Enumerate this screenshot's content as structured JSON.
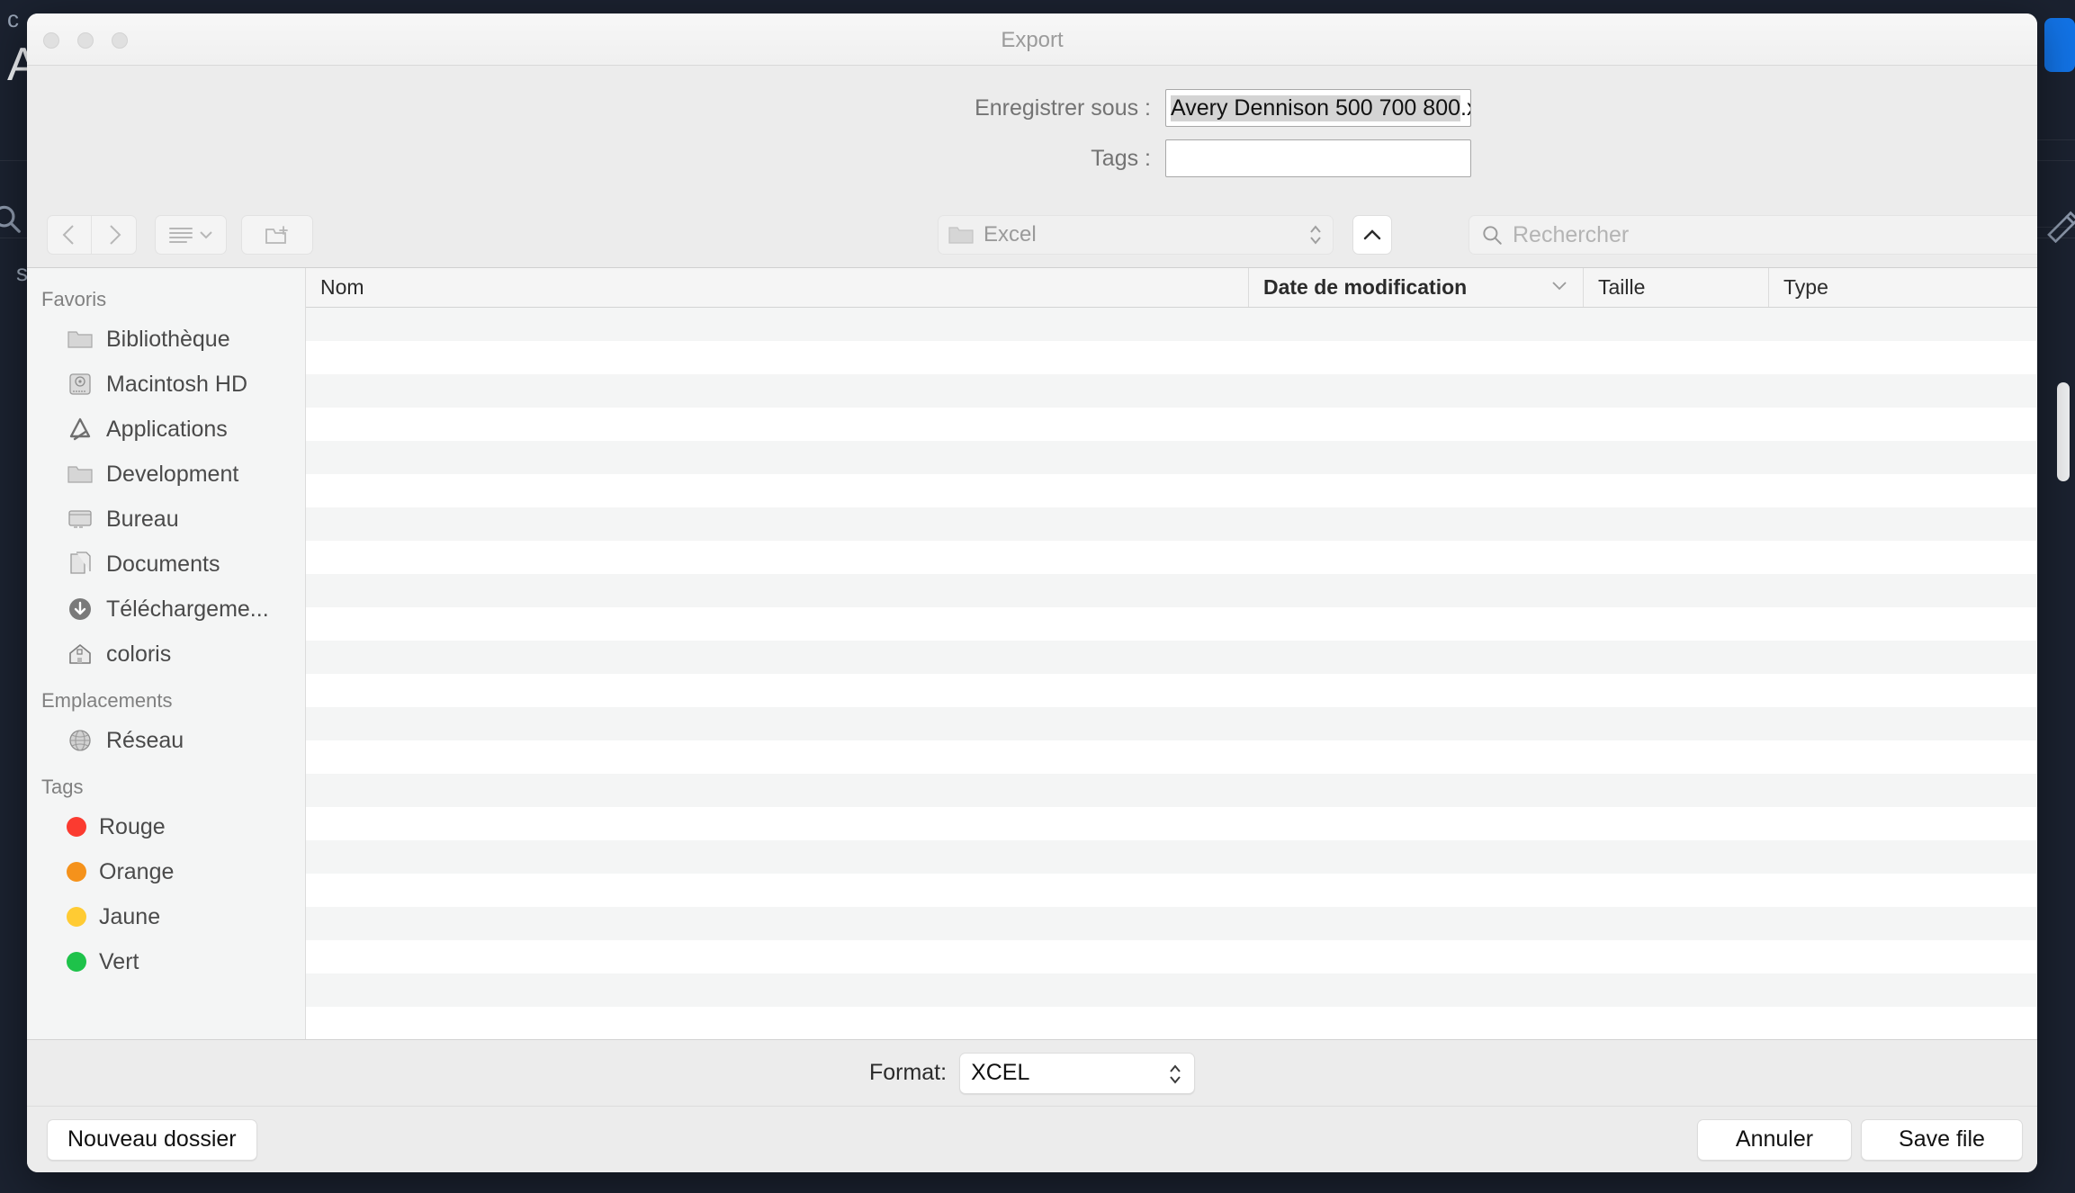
{
  "backdrop": {
    "fragment_top_left": "c",
    "fragment_letter": "A",
    "fragment_side": "s",
    "search_icon": "search-icon",
    "pencil_icon": "pencil-icon",
    "accent_color": "#1273e6",
    "background_color": "#1b2230"
  },
  "window": {
    "title": "Export",
    "traffic_lights": [
      "close",
      "minimize",
      "maximize"
    ]
  },
  "fields": {
    "save_as_label": "Enregistrer sous :",
    "filename_selected": "Avery Dennison 500 700 800",
    "filename_extension": ".xlsx",
    "tags_label": "Tags :",
    "tags_value": "",
    "tags_placeholder": ""
  },
  "toolbar": {
    "back_icon": "chevron-left-icon",
    "forward_icon": "chevron-right-icon",
    "view_icon": "list-view-icon",
    "view_chevron_icon": "chevron-down-icon",
    "new_folder_icon": "new-folder-icon",
    "path_folder_icon": "folder-icon",
    "path_value": "Excel",
    "path_stepper_icon": "stepper-updown-icon",
    "collapse_icon": "chevron-up-icon",
    "search_icon": "search-icon",
    "search_value": "",
    "search_placeholder": "Rechercher"
  },
  "sidebar": {
    "sections": [
      {
        "title": "Favoris",
        "items": [
          {
            "label": "Bibliothèque",
            "icon": "folder-icon"
          },
          {
            "label": "Macintosh HD",
            "icon": "hard-drive-icon"
          },
          {
            "label": "Applications",
            "icon": "applications-icon"
          },
          {
            "label": "Development",
            "icon": "folder-icon"
          },
          {
            "label": "Bureau",
            "icon": "desktop-icon"
          },
          {
            "label": "Documents",
            "icon": "documents-icon"
          },
          {
            "label": "Téléchargeme...",
            "icon": "downloads-icon"
          },
          {
            "label": "coloris",
            "icon": "home-icon"
          }
        ]
      },
      {
        "title": "Emplacements",
        "items": [
          {
            "label": "Réseau",
            "icon": "network-globe-icon"
          }
        ]
      },
      {
        "title": "Tags",
        "items": [
          {
            "label": "Rouge",
            "icon": "tag-dot-icon",
            "color": "#fb3b30"
          },
          {
            "label": "Orange",
            "icon": "tag-dot-icon",
            "color": "#f5921b"
          },
          {
            "label": "Jaune",
            "icon": "tag-dot-icon",
            "color": "#ffcb33"
          },
          {
            "label": "Vert",
            "icon": "tag-dot-icon",
            "color": "#1ec24a"
          }
        ]
      }
    ]
  },
  "filelist": {
    "columns": [
      {
        "key": "name",
        "label": "Nom",
        "sorted": false
      },
      {
        "key": "date",
        "label": "Date de modification",
        "sorted": true,
        "sort_icon": "chevron-down-icon"
      },
      {
        "key": "size",
        "label": "Taille",
        "sorted": false
      },
      {
        "key": "type",
        "label": "Type",
        "sorted": false
      }
    ],
    "rows": [],
    "empty_row_count": 15
  },
  "footer": {
    "format_label": "Format:",
    "format_value": "XCEL",
    "format_stepper_icon": "stepper-updown-icon",
    "new_folder_label": "Nouveau dossier",
    "cancel_label": "Annuler",
    "save_label": "Save file"
  }
}
